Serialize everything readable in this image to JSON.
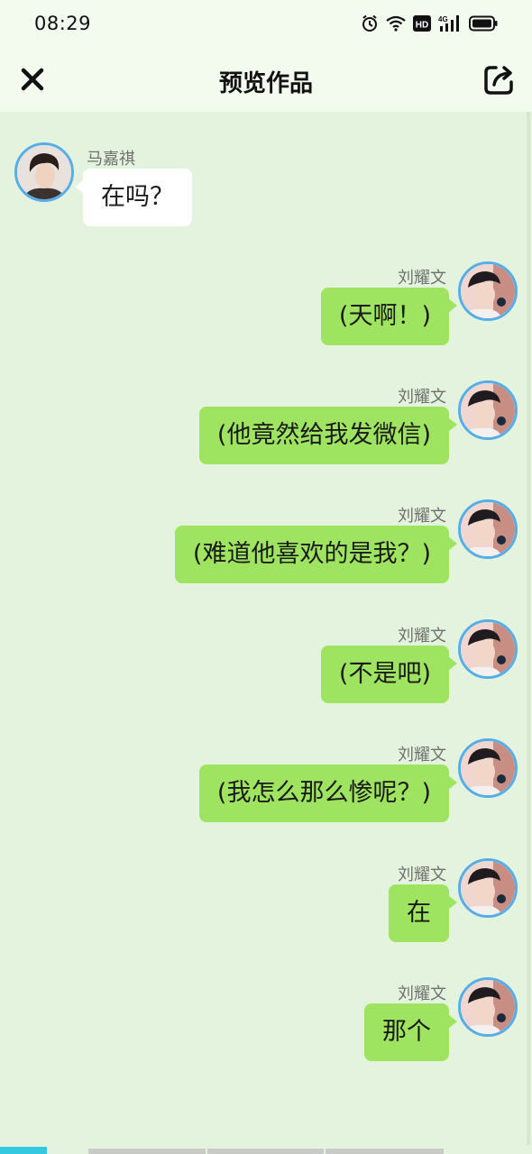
{
  "status_bar": {
    "time": "08:29",
    "icons": [
      "alarm-icon",
      "wifi-icon",
      "hd-icon",
      "4g-signal-icon",
      "battery-icon"
    ]
  },
  "nav": {
    "title": "预览作品",
    "close_icon": "close-icon",
    "share_icon": "share-icon"
  },
  "colors": {
    "page_bg": "#e4f3dd",
    "header_bg": "#f3fbef",
    "bubble_right": "#9fe460",
    "bubble_left": "#ffffff",
    "avatar_ring": "#55aee8",
    "progress_active": "#33c9e0"
  },
  "messages": [
    {
      "side": "left",
      "sender": "马嘉祺",
      "text": "在吗？"
    },
    {
      "side": "right",
      "sender": "刘耀文",
      "text": "(天啊！)"
    },
    {
      "side": "right",
      "sender": "刘耀文",
      "text": "(他竟然给我发微信)"
    },
    {
      "side": "right",
      "sender": "刘耀文",
      "text": "(难道他喜欢的是我？)"
    },
    {
      "side": "right",
      "sender": "刘耀文",
      "text": "(不是吧)"
    },
    {
      "side": "right",
      "sender": "刘耀文",
      "text": "(我怎么那么惨呢？)"
    },
    {
      "side": "right",
      "sender": "刘耀文",
      "text": "在"
    },
    {
      "side": "right",
      "sender": "刘耀文",
      "text": "那个"
    }
  ]
}
